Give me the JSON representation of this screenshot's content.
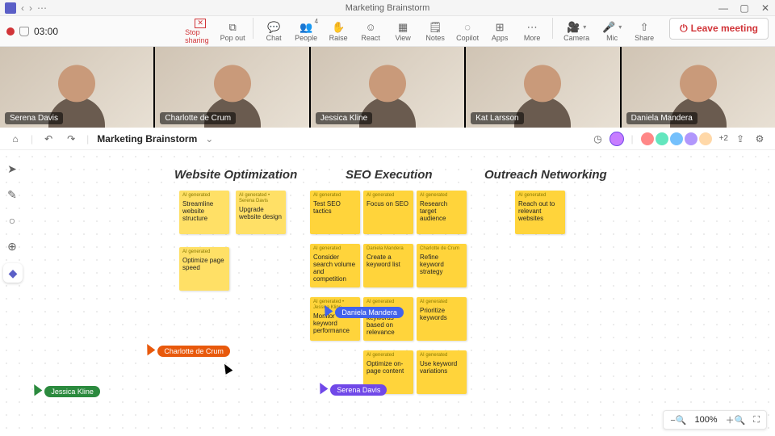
{
  "titlebar": {
    "title": "Marketing Brainstorm"
  },
  "recording": {
    "time": "03:00"
  },
  "toolbar": {
    "stop_sharing": "Stop sharing",
    "pop_out": "Pop out",
    "chat": "Chat",
    "people": "People",
    "people_count": "4",
    "raise": "Raise",
    "react": "React",
    "view": "View",
    "notes": "Notes",
    "copilot": "Copilot",
    "apps": "Apps",
    "more": "More",
    "camera": "Camera",
    "mic": "Mic",
    "share": "Share",
    "leave": "Leave meeting"
  },
  "videos": [
    {
      "name": "Serena Davis"
    },
    {
      "name": "Charlotte de Crum"
    },
    {
      "name": "Jessica Kline"
    },
    {
      "name": "Kat Larsson"
    },
    {
      "name": "Daniela Mandera"
    }
  ],
  "whiteboard": {
    "title": "Marketing Brainstorm",
    "extra_avatars": "+2",
    "sections": {
      "website": "Website Optimization",
      "seo": "SEO Execution",
      "outreach": "Outreach Networking"
    },
    "stickies": {
      "ws1": {
        "tag": "AI generated",
        "text": "Streamline website structure"
      },
      "ws2": {
        "tag": "AI generated • Serena Davis",
        "text": "Upgrade website design"
      },
      "ws3": {
        "tag": "AI generated",
        "text": "Optimize page speed"
      },
      "seo1": {
        "tag": "AI generated",
        "text": "Test SEO tactics"
      },
      "seo2": {
        "tag": "AI generated",
        "text": "Focus on SEO"
      },
      "seo3": {
        "tag": "AI generated",
        "text": "Research target audience"
      },
      "seo4": {
        "tag": "AI generated",
        "text": "Consider search volume and competition"
      },
      "seo5": {
        "tag": "Daniela Mandera",
        "text": "Create a keyword list"
      },
      "seo6": {
        "tag": "Charlotte de Crum",
        "text": "Refine keyword strategy"
      },
      "seo7": {
        "tag": "AI generated • Jessica Kline",
        "text": "Monitor keyword performance"
      },
      "seo8": {
        "tag": "AI generated",
        "text": "Rank keywords based on relevance"
      },
      "seo9": {
        "tag": "AI generated",
        "text": "Prioritize keywords"
      },
      "seo10": {
        "tag": "AI generated",
        "text": "Optimize on-page content"
      },
      "seo11": {
        "tag": "AI generated",
        "text": "Use keyword variations"
      },
      "out1": {
        "tag": "AI generated",
        "text": "Reach out to relevant websites"
      }
    },
    "cursors": {
      "charlotte": {
        "label": "Charlotte de Crum",
        "color": "#e8590c"
      },
      "jessica": {
        "label": "Jessica Kline",
        "color": "#2b8a3e"
      },
      "daniela": {
        "label": "Daniela Mandera",
        "color": "#4263eb"
      },
      "serena": {
        "label": "Serena Davis",
        "color": "#7048e8"
      }
    },
    "zoom": "100%"
  }
}
